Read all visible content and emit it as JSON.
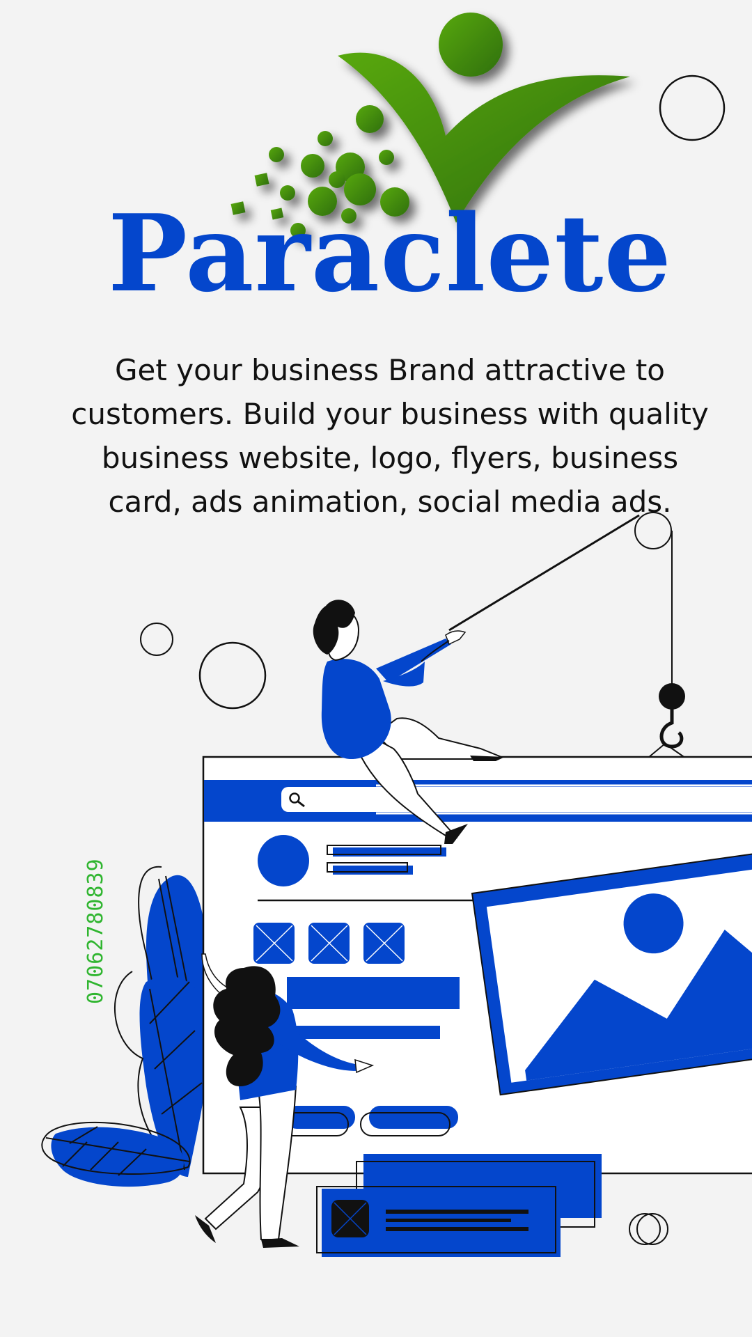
{
  "brand": {
    "name": "Paraclete",
    "logo_icon": "person-checkmark-logo"
  },
  "tagline": "Get your business Brand attractive to customers. Build your business with quality business website, logo, flyers, business card, ads animation, social media ads.",
  "contact": {
    "phone": "07062780839"
  },
  "colors": {
    "brand_blue": "#0446cc",
    "logo_green": "#3f8c0e",
    "phone_green": "#2fb52f",
    "ink": "#111111",
    "background": "#f3f3f3"
  },
  "illustration": {
    "icons": [
      "search-icon",
      "image-placeholder-icon",
      "avatar-circle-icon"
    ]
  }
}
